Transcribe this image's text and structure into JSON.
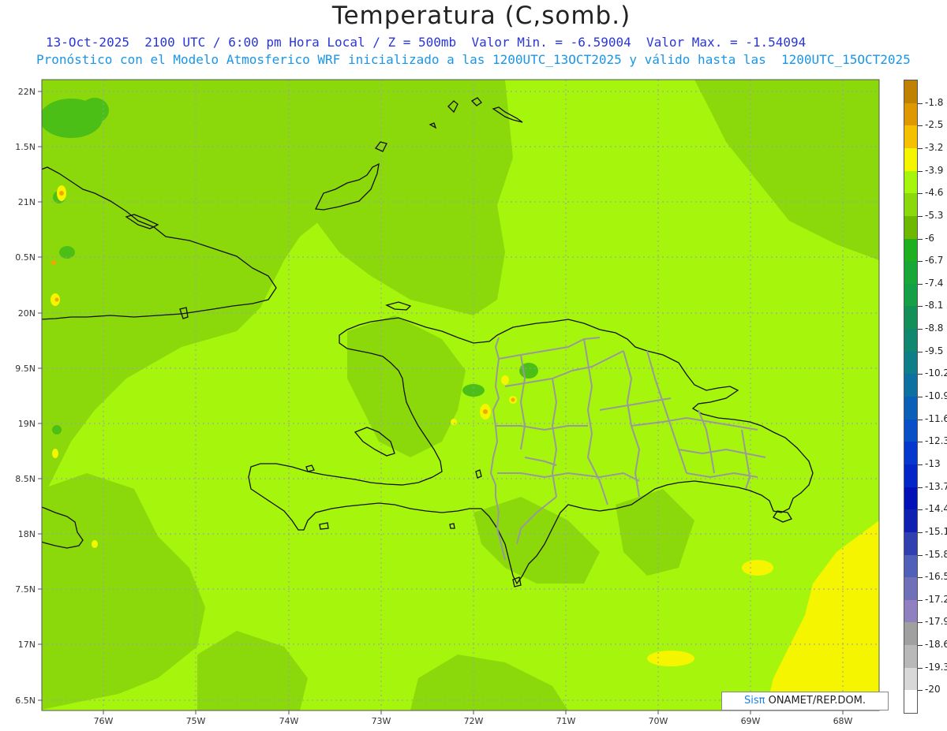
{
  "header": {
    "title": "Temperatura (C,somb.)",
    "subtitle1": "13-Oct-2025  2100 UTC / 6:00 pm Hora Local / Z = 500mb  Valor Min. = -6.59004  Valor Max. = -1.54094",
    "subtitle2": "Pronóstico con el Modelo Atmosferico WRF inicializado a las 1200UTC_13OCT2025 y válido hasta las  1200UTC_15OCT2025"
  },
  "map": {
    "lon_labels": [
      "76W",
      "75W",
      "74W",
      "73W",
      "72W",
      "71W",
      "70W",
      "69W",
      "68W"
    ],
    "lat_labels": [
      "22N",
      "1.5N",
      "21N",
      "0.5N",
      "20N",
      "9.5N",
      "19N",
      "8.5N",
      "18N",
      "7.5N",
      "17N",
      "6.5N"
    ],
    "lon_range": [
      -76.67,
      -67.63
    ],
    "lat_range": [
      16.42,
      22.1
    ],
    "base_color": "#a6f50d",
    "regions": {
      "level_-5_3": "#8cd90b",
      "level_-4_6": "#a6f50d",
      "level_-3_9": "#f5f500",
      "level_-6": "#4cbf17",
      "level_-2_5": "#f5a500"
    }
  },
  "colorbar": {
    "labels": [
      "-1.8",
      "-2.5",
      "-3.2",
      "-3.9",
      "-4.6",
      "-5.3",
      "-6",
      "-6.7",
      "-7.4",
      "-8.1",
      "-8.8",
      "-9.5",
      "-10.2",
      "-10.9",
      "-11.6",
      "-12.3",
      "-13",
      "-13.7",
      "-14.4",
      "-15.1",
      "-15.8",
      "-16.5",
      "-17.2",
      "-17.9",
      "-18.6",
      "-19.3",
      "-20"
    ],
    "colors": [
      "#c08000",
      "#e09800",
      "#f5c000",
      "#f5f500",
      "#a6f50d",
      "#8cd90b",
      "#6fb800",
      "#1eb01e",
      "#18a838",
      "#15a048",
      "#129058",
      "#108870",
      "#0e7f88",
      "#0c70a0",
      "#0a60b8",
      "#0850c8",
      "#0638d0",
      "#0425c8",
      "#0210b8",
      "#1020b0",
      "#3040b0",
      "#5060b8",
      "#7070b8",
      "#9080c0",
      "#a0a0a0",
      "#b8b8b8",
      "#d8d8d8",
      "#ffffff"
    ]
  },
  "credit": {
    "brand": "Sisπ",
    "text": " ONAMET/REP.DOM."
  }
}
